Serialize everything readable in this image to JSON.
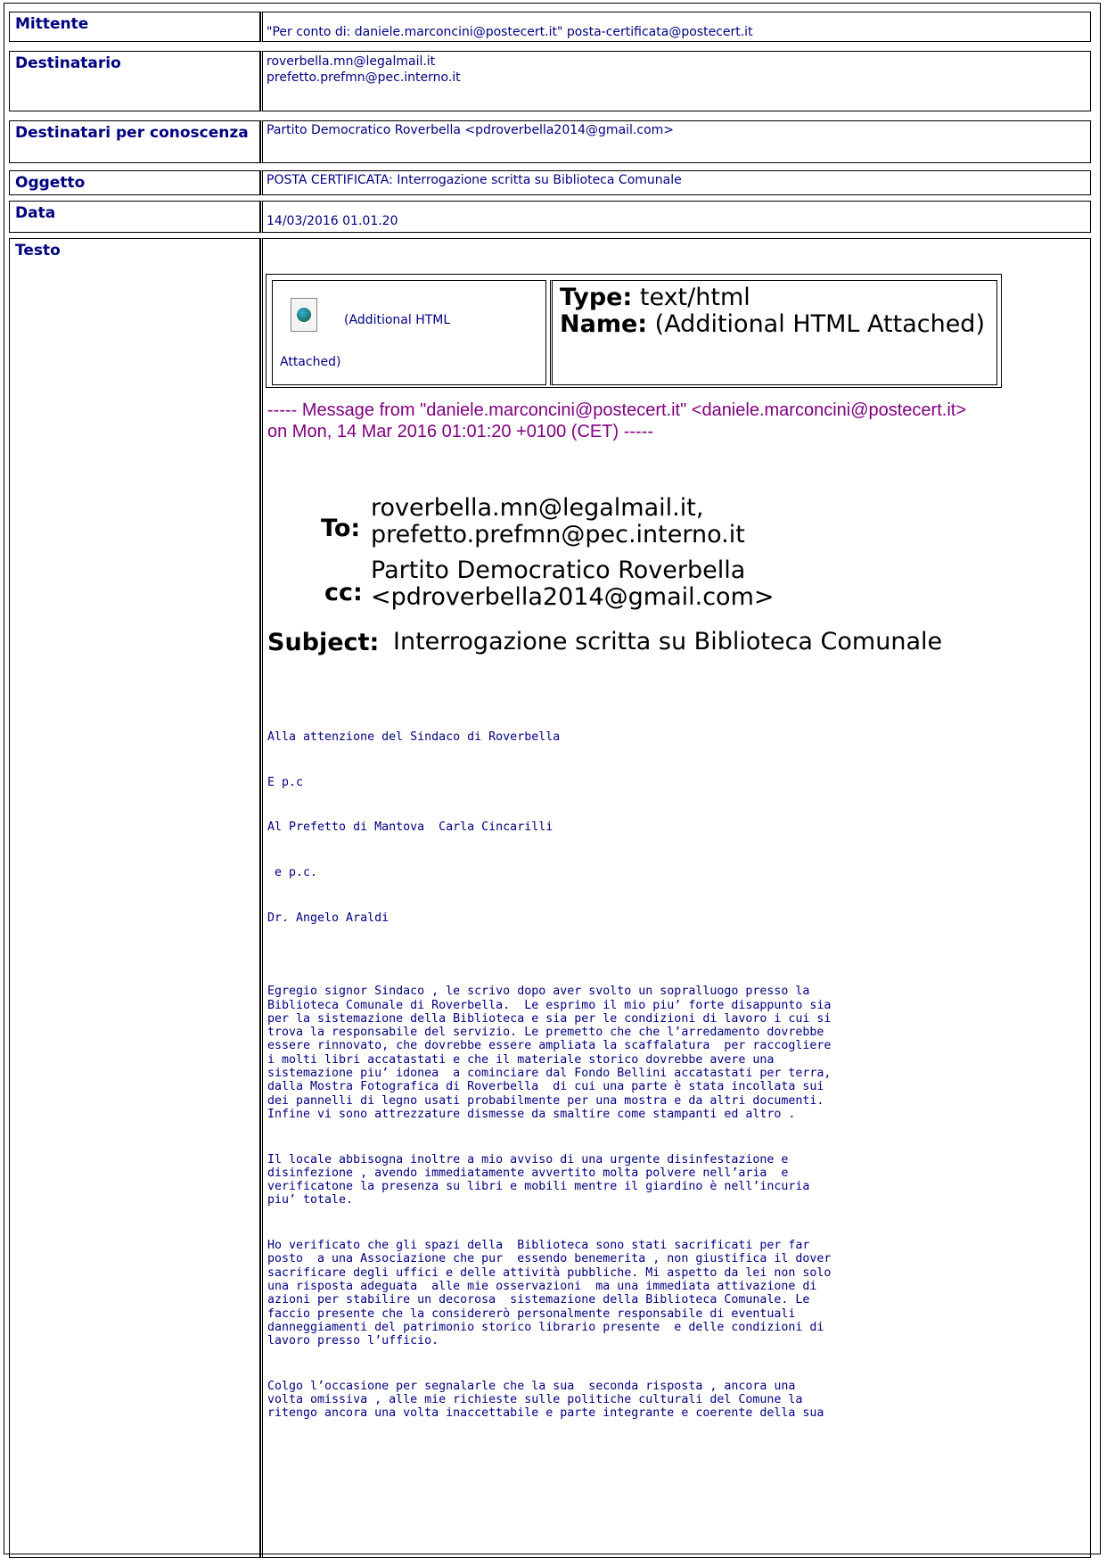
{
  "fields": {
    "mittente_label": "Mittente",
    "mittente_value": "\"Per conto di: daniele.marconcini@postecert.it\" posta-certificata@postecert.it",
    "destinatario_label": "Destinatario",
    "destinatario_value_1": "roverbella.mn@legalmail.it",
    "destinatario_value_2": "prefetto.prefmn@pec.interno.it",
    "cc_label": "Destinatari per conoscenza",
    "cc_value": "Partito Democratico Roverbella <pdroverbella2014@gmail.com>",
    "oggetto_label": "Oggetto",
    "oggetto_value": "POSTA CERTIFICATA: Interrogazione scritta su Biblioteca Comunale",
    "data_label": "Data",
    "data_value": "14/03/2016 01.01.20",
    "testo_label": "Testo"
  },
  "attachment": {
    "link_line1": "(Additional HTML",
    "link_line2": "Attached)",
    "type_label": "Type:",
    "type_value": "text/html",
    "name_label": "Name:",
    "name_value": "(Additional HTML Attached)"
  },
  "message_from": "----- Message from \"daniele.marconcini@postecert.it\" <daniele.marconcini@postecert.it> on Mon, 14 Mar 2016 01:01:20 +0100 (CET) -----",
  "headers": {
    "to_label": "To:",
    "to_value_1": "roverbella.mn@legalmail.it,",
    "to_value_2": "prefetto.prefmn@pec.interno.it",
    "cc_label": "cc:",
    "cc_value_1": "Partito Democratico Roverbella",
    "cc_value_2": "<pdroverbella2014@gmail.com>",
    "subject_label": "Subject:",
    "subject_value": "Interrogazione scritta su Biblioteca Comunale"
  },
  "body": {
    "p1": "Alla attenzione del Sindaco di Roverbella",
    "p2": "E p.c",
    "p3": "Al Prefetto di Mantova  Carla Cincarilli",
    "p4": " e p.c.",
    "p5": "Dr. Angelo Araldi",
    "p6": "Egregio signor Sindaco , le scrivo dopo aver svolto un sopralluogo presso la\nBiblioteca Comunale di Roverbella.  Le esprimo il mio piu’ forte disappunto sia\nper la sistemazione della Biblioteca e sia per le condizioni di lavoro i cui si\ntrova la responsabile del servizio. Le premetto che che l’arredamento dovrebbe\nessere rinnovato, che dovrebbe essere ampliata la scaffalatura  per raccogliere\ni molti libri accatastati e che il materiale storico dovrebbe avere una\nsistemazione piu’ idonea  a cominciare dal Fondo Bellini accatastati per terra,\ndalla Mostra Fotografica di Roverbella  di cui una parte è stata incollata sui\ndei pannelli di legno usati probabilmente per una mostra e da altri documenti.\nInfine vi sono attrezzature dismesse da smaltire come stampanti ed altro .",
    "p7": "Il locale abbisogna inoltre a mio avviso di una urgente disinfestazione e\ndisinfezione , avendo immediatamente avvertito molta polvere nell’aria  e\nverificatone la presenza su libri e mobili mentre il giardino è nell’incuria\npiu’ totale.",
    "p8": "Ho verificato che gli spazi della  Biblioteca sono stati sacrificati per far\nposto  a una Associazione che pur  essendo benemerita , non giustifica il dover\nsacrificare degli uffici e delle attività pubbliche. Mi aspetto da lei non solo\nuna risposta adeguata  alle mie osservazioni  ma una immediata attivazione di\nazioni per stabilire un decorosa  sistemazione della Biblioteca Comunale. Le\nfaccio presente che la considererò personalmente responsabile di eventuali\ndanneggiamenti del patrimonio storico librario presente  e delle condizioni di\nlavoro presso l’ufficio.",
    "p9": "Colgo l’occasione per segnalarle che la sua  seconda risposta , ancora una\nvolta omissiva , alle mie richieste sulle politiche culturali del Comune la\nritengo ancora una volta inaccettabile e parte integrante e coerente della sua"
  }
}
